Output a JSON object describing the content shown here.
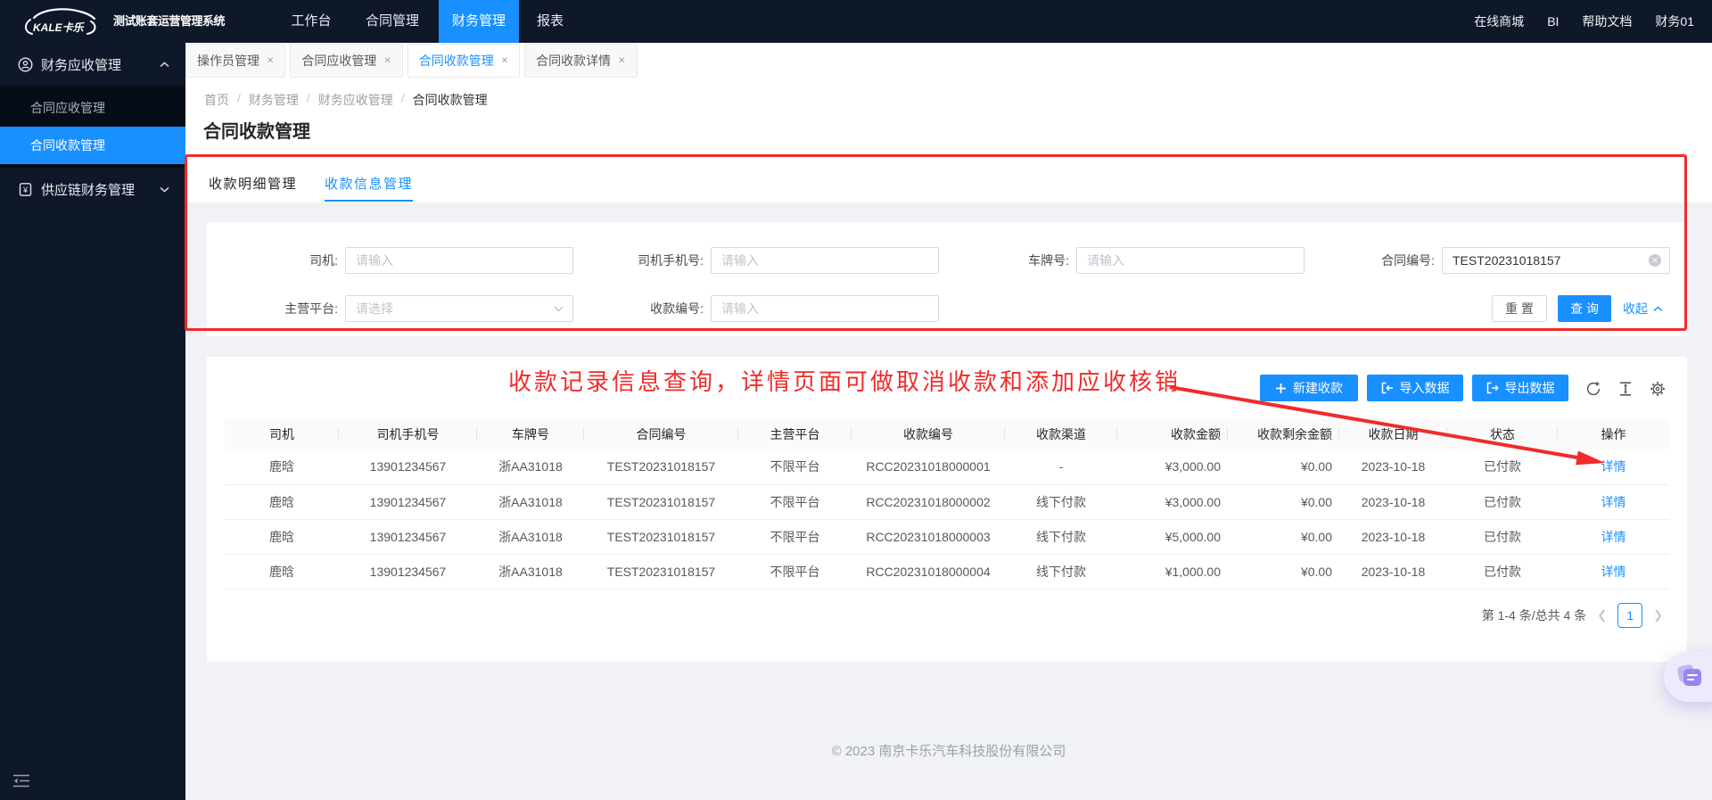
{
  "topbar": {
    "brand": "KALE卡乐",
    "system_title": "测试账套运营管理系统",
    "nav": [
      {
        "label": "工作台",
        "active": false
      },
      {
        "label": "合同管理",
        "active": false
      },
      {
        "label": "财务管理",
        "active": true
      },
      {
        "label": "报表",
        "active": false
      }
    ],
    "right_items": [
      "在线商城",
      "BI",
      "帮助文档",
      "财务01"
    ]
  },
  "sidebar": {
    "groups": [
      {
        "label": "财务应收管理",
        "icon": "receivable-icon",
        "expanded": true,
        "items": [
          {
            "label": "合同应收管理",
            "active": false
          },
          {
            "label": "合同收款管理",
            "active": true
          }
        ]
      },
      {
        "label": "供应链财务管理",
        "icon": "supply-finance-icon",
        "expanded": false,
        "items": []
      }
    ]
  },
  "workspace_tabs": [
    {
      "label": "操作员管理",
      "active": false
    },
    {
      "label": "合同应收管理",
      "active": false
    },
    {
      "label": "合同收款管理",
      "active": true
    },
    {
      "label": "合同收款详情",
      "active": false
    }
  ],
  "breadcrumb": [
    "首页",
    "财务管理",
    "财务应收管理",
    "合同收款管理"
  ],
  "page_title": "合同收款管理",
  "sub_tabs": [
    {
      "label": "收款明细管理",
      "active": false
    },
    {
      "label": "收款信息管理",
      "active": true
    }
  ],
  "filters": {
    "row1": [
      {
        "label": "司机:",
        "placeholder": "请输入",
        "value": "",
        "type": "input"
      },
      {
        "label": "司机手机号:",
        "placeholder": "请输入",
        "value": "",
        "type": "input"
      },
      {
        "label": "车牌号:",
        "placeholder": "请输入",
        "value": "",
        "type": "input"
      },
      {
        "label": "合同编号:",
        "placeholder": "",
        "value": "TEST20231018157",
        "type": "input",
        "clearable": true
      }
    ],
    "row2": [
      {
        "label": "主营平台:",
        "placeholder": "请选择",
        "value": "",
        "type": "select"
      },
      {
        "label": "收款编号:",
        "placeholder": "请输入",
        "value": "",
        "type": "input"
      }
    ],
    "reset_label": "重 置",
    "search_label": "查 询",
    "collapse_label": "收起"
  },
  "annotation": {
    "text": "收款记录信息查询，详情页面可做取消收款和添加应收核销"
  },
  "toolbar": {
    "buttons": [
      {
        "label": "新建收款",
        "icon": "plus-icon"
      },
      {
        "label": "导入数据",
        "icon": "import-icon"
      },
      {
        "label": "导出数据",
        "icon": "export-icon"
      }
    ]
  },
  "table": {
    "columns": [
      "司机",
      "司机手机号",
      "车牌号",
      "合同编号",
      "主营平台",
      "收款编号",
      "收款渠道",
      "收款金额",
      "收款剩余金额",
      "收款日期",
      "状态",
      "操作"
    ],
    "action_label": "详情",
    "rows": [
      [
        "鹿晗",
        "13901234567",
        "浙AA31018",
        "TEST20231018157",
        "不限平台",
        "RCC20231018000001",
        "-",
        "¥3,000.00",
        "¥0.00",
        "2023-10-18",
        "已付款"
      ],
      [
        "鹿晗",
        "13901234567",
        "浙AA31018",
        "TEST20231018157",
        "不限平台",
        "RCC20231018000002",
        "线下付款",
        "¥3,000.00",
        "¥0.00",
        "2023-10-18",
        "已付款"
      ],
      [
        "鹿晗",
        "13901234567",
        "浙AA31018",
        "TEST20231018157",
        "不限平台",
        "RCC20231018000003",
        "线下付款",
        "¥5,000.00",
        "¥0.00",
        "2023-10-18",
        "已付款"
      ],
      [
        "鹿晗",
        "13901234567",
        "浙AA31018",
        "TEST20231018157",
        "不限平台",
        "RCC20231018000004",
        "线下付款",
        "¥1,000.00",
        "¥0.00",
        "2023-10-18",
        "已付款"
      ]
    ]
  },
  "pagination": {
    "summary": "第 1-4 条/总共 4 条",
    "current": "1"
  },
  "footer": {
    "copyright": "© 2023 南京卡乐汽车科技股份有限公司"
  },
  "colors": {
    "accent": "#1890ff",
    "annotation_red": "#f12b2b",
    "topbar_bg": "#0e1828",
    "submenu_bg": "#050d18"
  }
}
